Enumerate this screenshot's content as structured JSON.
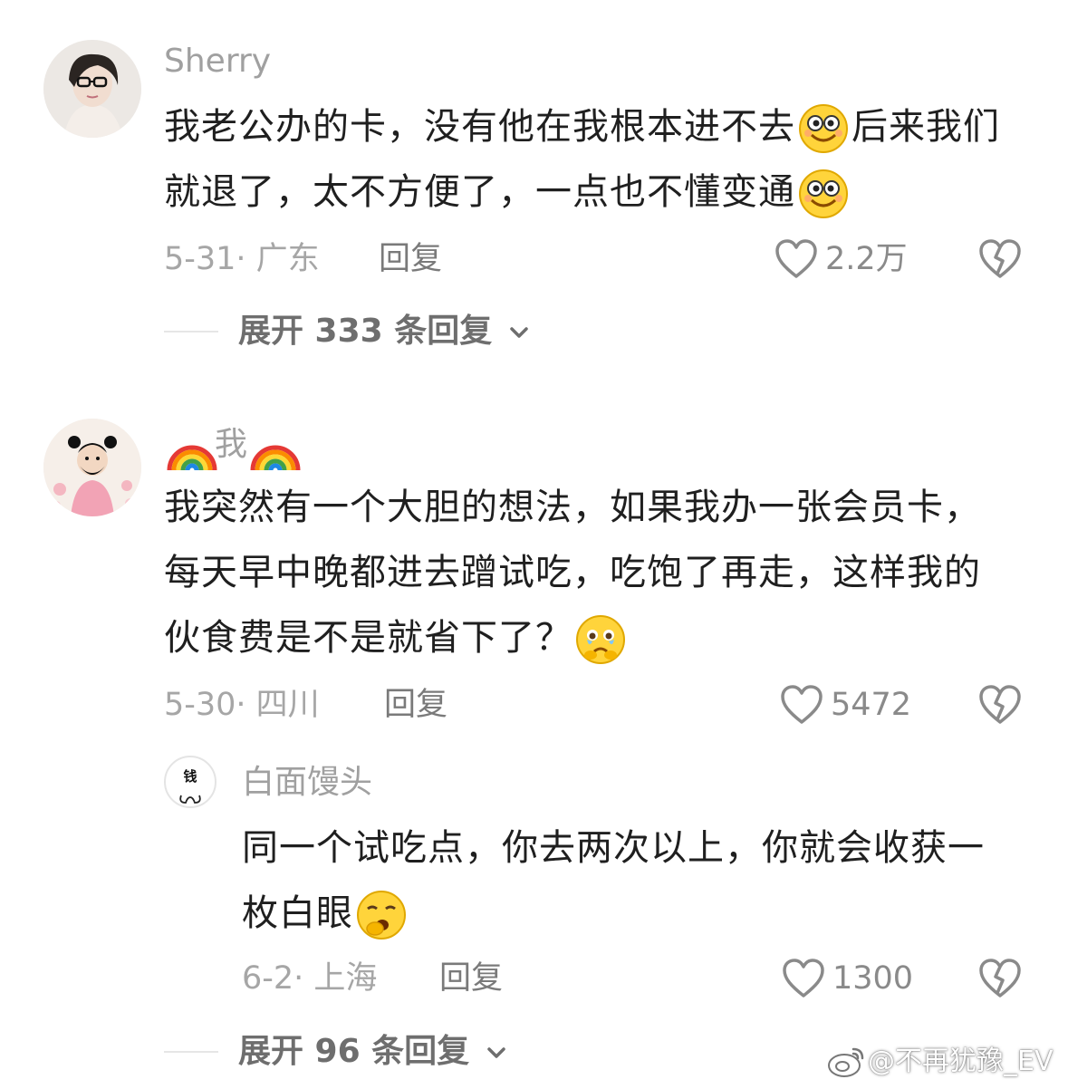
{
  "comments": [
    {
      "username": "Sherry",
      "text_part1": "我老公办的卡，没有他在我根本进不去",
      "emoji1": "smiling-face-emoji",
      "text_part2": "后来我们就退了，太不方便了，一点也不懂变通",
      "emoji2": "smiling-face-emoji",
      "date_location": "5-31· 广东",
      "reply_label": "回复",
      "likes": "2.2万",
      "expand_label": "展开 333 条回复"
    },
    {
      "username_prefix_icon": "rainbow-emoji",
      "username": "我",
      "username_suffix_icon": "rainbow-emoji",
      "text_part1": "我突然有一个大胆的想法，如果我办一张会员卡，每天早中晚都进去蹭试吃，吃饱了再走，这样我的伙食费是不是就省下了？",
      "emoji1": "holding-back-tears-emoji",
      "date_location": "5-30· 四川",
      "reply_label": "回复",
      "likes": "5472"
    }
  ],
  "reply": {
    "avatar_text": "钱",
    "username": "白面馒头",
    "text_part1": "同一个试吃点，你去两次以上，你就会收获一枚白眼",
    "emoji1": "yawning-face-emoji",
    "date_location": "6-2· 上海",
    "reply_label": "回复",
    "likes": "1300",
    "expand_label": "展开 96 条回复"
  },
  "watermark": "@不再犹豫_EV",
  "colors": {
    "username": "#a0a0a0",
    "content": "#1f1f1f",
    "meta": "#a6a6a6",
    "icon": "#888888"
  }
}
